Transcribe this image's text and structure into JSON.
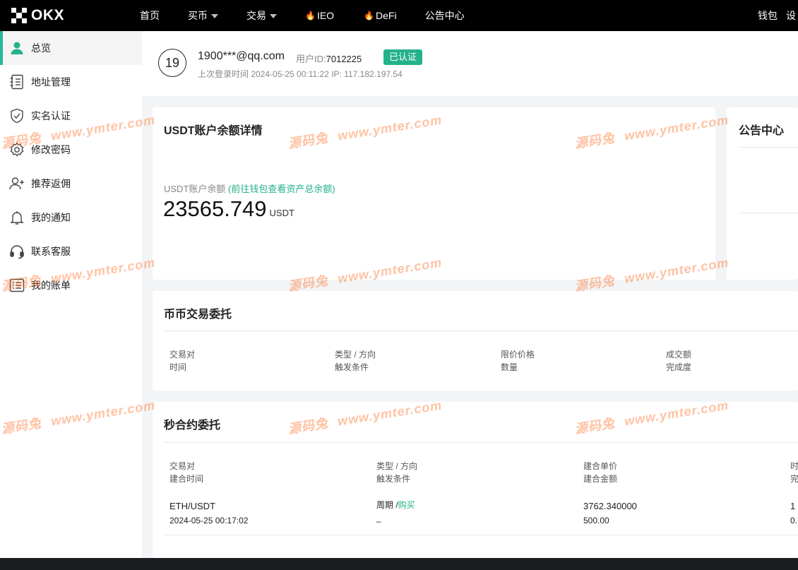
{
  "brand": {
    "name": "OKX"
  },
  "nav": {
    "items": [
      {
        "label": "首页",
        "dropdown": false,
        "hot": false
      },
      {
        "label": "买币",
        "dropdown": true,
        "hot": false
      },
      {
        "label": "交易",
        "dropdown": true,
        "hot": false
      },
      {
        "label": "IEO",
        "dropdown": false,
        "hot": true
      },
      {
        "label": "DeFi",
        "dropdown": false,
        "hot": true
      },
      {
        "label": "公告中心",
        "dropdown": false,
        "hot": false
      }
    ],
    "wallet": "钱包",
    "extra": "设"
  },
  "sidebar": {
    "items": [
      {
        "label": "总览",
        "icon": "user-icon",
        "active": true
      },
      {
        "label": "地址管理",
        "icon": "address-book-icon",
        "active": false
      },
      {
        "label": "实名认证",
        "icon": "shield-check-icon",
        "active": false
      },
      {
        "label": "修改密码",
        "icon": "gear-icon",
        "active": false
      },
      {
        "label": "推荐返佣",
        "icon": "add-user-icon",
        "active": false
      },
      {
        "label": "我的通知",
        "icon": "bell-icon",
        "active": false
      },
      {
        "label": "联系客服",
        "icon": "headset-icon",
        "active": false
      },
      {
        "label": "我的账单",
        "icon": "list-icon",
        "active": false
      }
    ]
  },
  "profile": {
    "avatar": "19",
    "email": "1900***@qq.com",
    "uid_label": "用户ID:",
    "uid": "7012225",
    "verified": "已认证",
    "last_login": "上次登录时间 2024-05-25 00:11:22  IP: 117.182.197.54"
  },
  "balance": {
    "title": "USDT账户余额详情",
    "label": "USDT账户余额",
    "link": "(前往钱包查看资产总余额)",
    "value": "23565.749",
    "unit": "USDT"
  },
  "announcements": {
    "title": "公告中心"
  },
  "spot_orders": {
    "title": "币币交易委托",
    "columns": [
      {
        "line1": "交易对",
        "line2": "时间"
      },
      {
        "line1": "类型 / 方向",
        "line2": "触发条件"
      },
      {
        "line1": "限价价格",
        "line2": "数量"
      },
      {
        "line1": "成交额",
        "line2": "完成度"
      }
    ]
  },
  "contract_orders": {
    "title": "秒合约委托",
    "columns": [
      {
        "line1": "交易对",
        "line2": "建合时间"
      },
      {
        "line1": "类型 / 方向",
        "line2": "触发条件"
      },
      {
        "line1": "建合单价",
        "line2": "建合金额"
      },
      {
        "line1": "时",
        "line2": "完"
      }
    ],
    "rows": [
      {
        "pair": "ETH/USDT",
        "time": "2024-05-25 00:17:02",
        "type": "周期 /",
        "direction": "购买",
        "trigger": "–",
        "price": "3762.340000",
        "amount": "500.00",
        "col4a": "1",
        "col4b": "0."
      }
    ]
  },
  "watermark": {
    "cn": "源码兔",
    "url": "www.ymter.com"
  },
  "colors": {
    "accent": "#23b28a",
    "nav_bg": "#000000",
    "watermark": "#ff7832"
  }
}
